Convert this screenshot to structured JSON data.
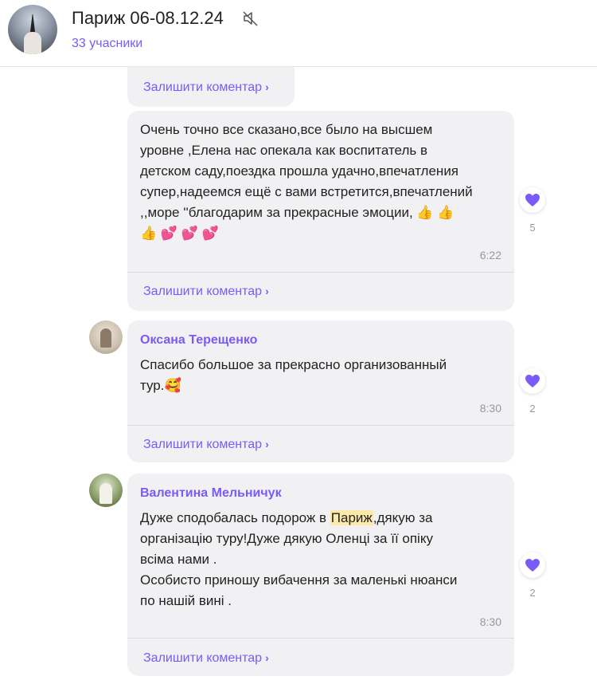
{
  "header": {
    "title": "Париж 06-08.12.24",
    "subtitle": "33 учасники",
    "mute_icon": "muted-speaker-icon"
  },
  "comment_link_label": "Залишити коментар",
  "colors": {
    "accent": "#7a5af8",
    "bubble": "#f1f1f3",
    "highlight": "#fde9a8"
  },
  "messages": [
    {
      "id": "m0",
      "partial": true
    },
    {
      "id": "m1",
      "lines": [
        "Очень точно все сказано,все было на высшем",
        "уровне ,Елена нас опекала как воспитатель в",
        "детском саду,поездка прошла удачно,впечатления",
        "супер,надеемся ещё с вами встретится,впечатлений",
        ",,море ''благодарим за прекрасные эмоции, 👍 👍",
        "👍 💕 💕 💕"
      ],
      "time": "6:22",
      "reaction_count": "5"
    },
    {
      "id": "m2",
      "author": "Оксана Терещенко",
      "lines": [
        "Спасибо большое за прекрасно организованный",
        "тур.🥰"
      ],
      "time": "8:30",
      "reaction_count": "2"
    },
    {
      "id": "m3",
      "author": "Валентина Мельничук",
      "line1_before": "Дуже сподобалась подорож в ",
      "line1_highlight": "Париж",
      "line1_after": ",дякую за",
      "lines_rest": [
        "організацію туру!Дуже дякую Оленці за її опіку",
        "всіма нами .",
        "Особисто приношу вибачення за маленькі нюанси",
        "по нашій вині  ."
      ],
      "time": "8:30",
      "reaction_count": "2"
    }
  ]
}
